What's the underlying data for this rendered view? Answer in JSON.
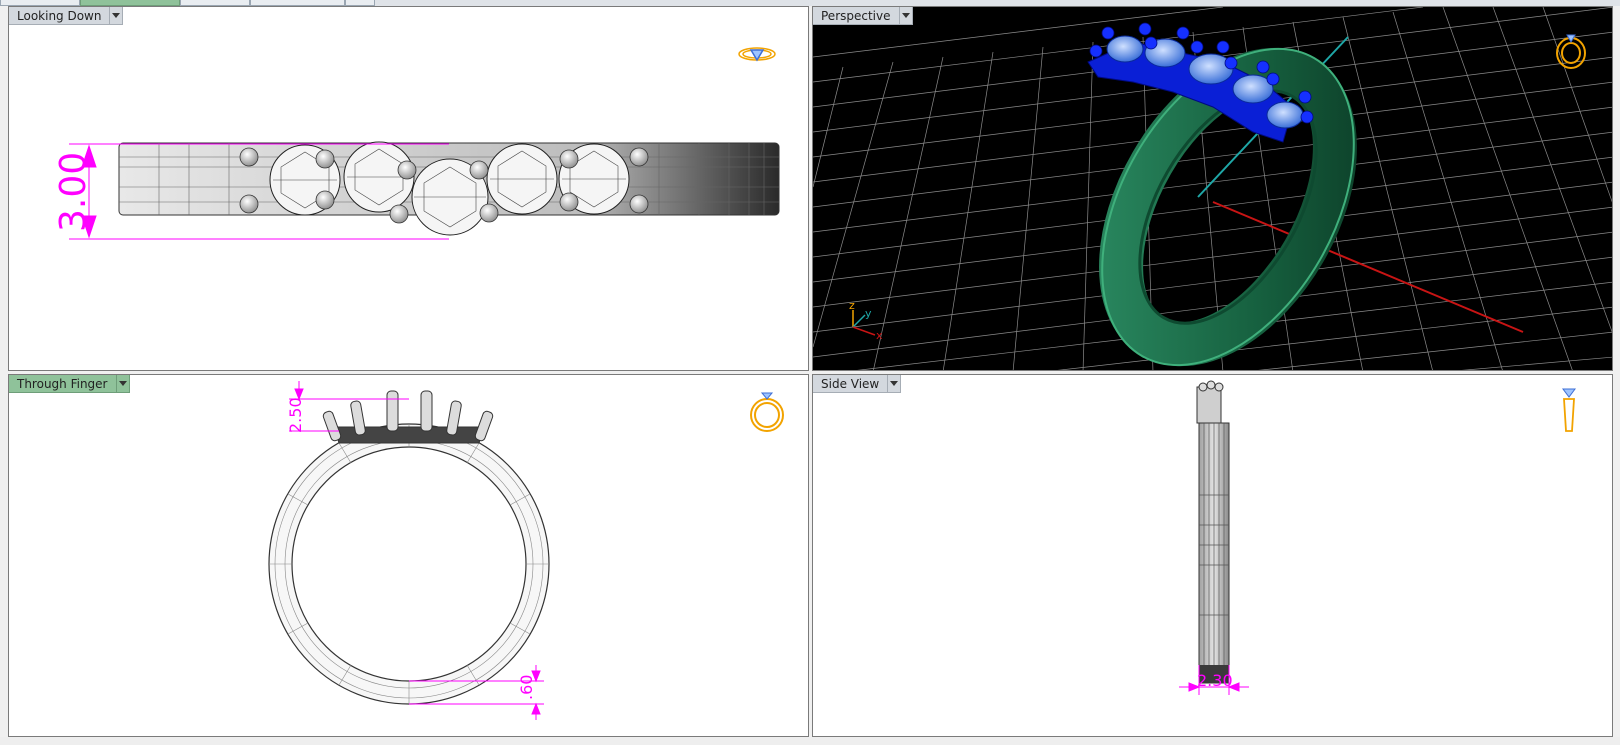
{
  "viewports": [
    {
      "id": "top-left",
      "label": "Looking Down",
      "active": false,
      "dimension": "3.00"
    },
    {
      "id": "top-right",
      "label": "Perspective",
      "active": false,
      "axes": {
        "z": "z",
        "y": "y",
        "x": "x"
      }
    },
    {
      "id": "bottom-left",
      "label": "Through Finger",
      "active": true,
      "dimensions": [
        "2.50",
        ".60"
      ]
    },
    {
      "id": "bottom-right",
      "label": "Side View",
      "active": false,
      "dimension": "2.30"
    }
  ],
  "colors": {
    "dimension": "#ff00ff",
    "active_label": "#8fc29a",
    "label": "#d3d8de",
    "ring_green": "#1f7a52",
    "setting_blue": "#0a1fd6",
    "grid": "#8c8c8c",
    "axis_x": "#c81414",
    "axis_y": "#1fa7a7"
  },
  "icons": {
    "viewport_ring_icon": "ring-with-gem-icon",
    "dropdown_icon": "chevron-down-icon"
  }
}
